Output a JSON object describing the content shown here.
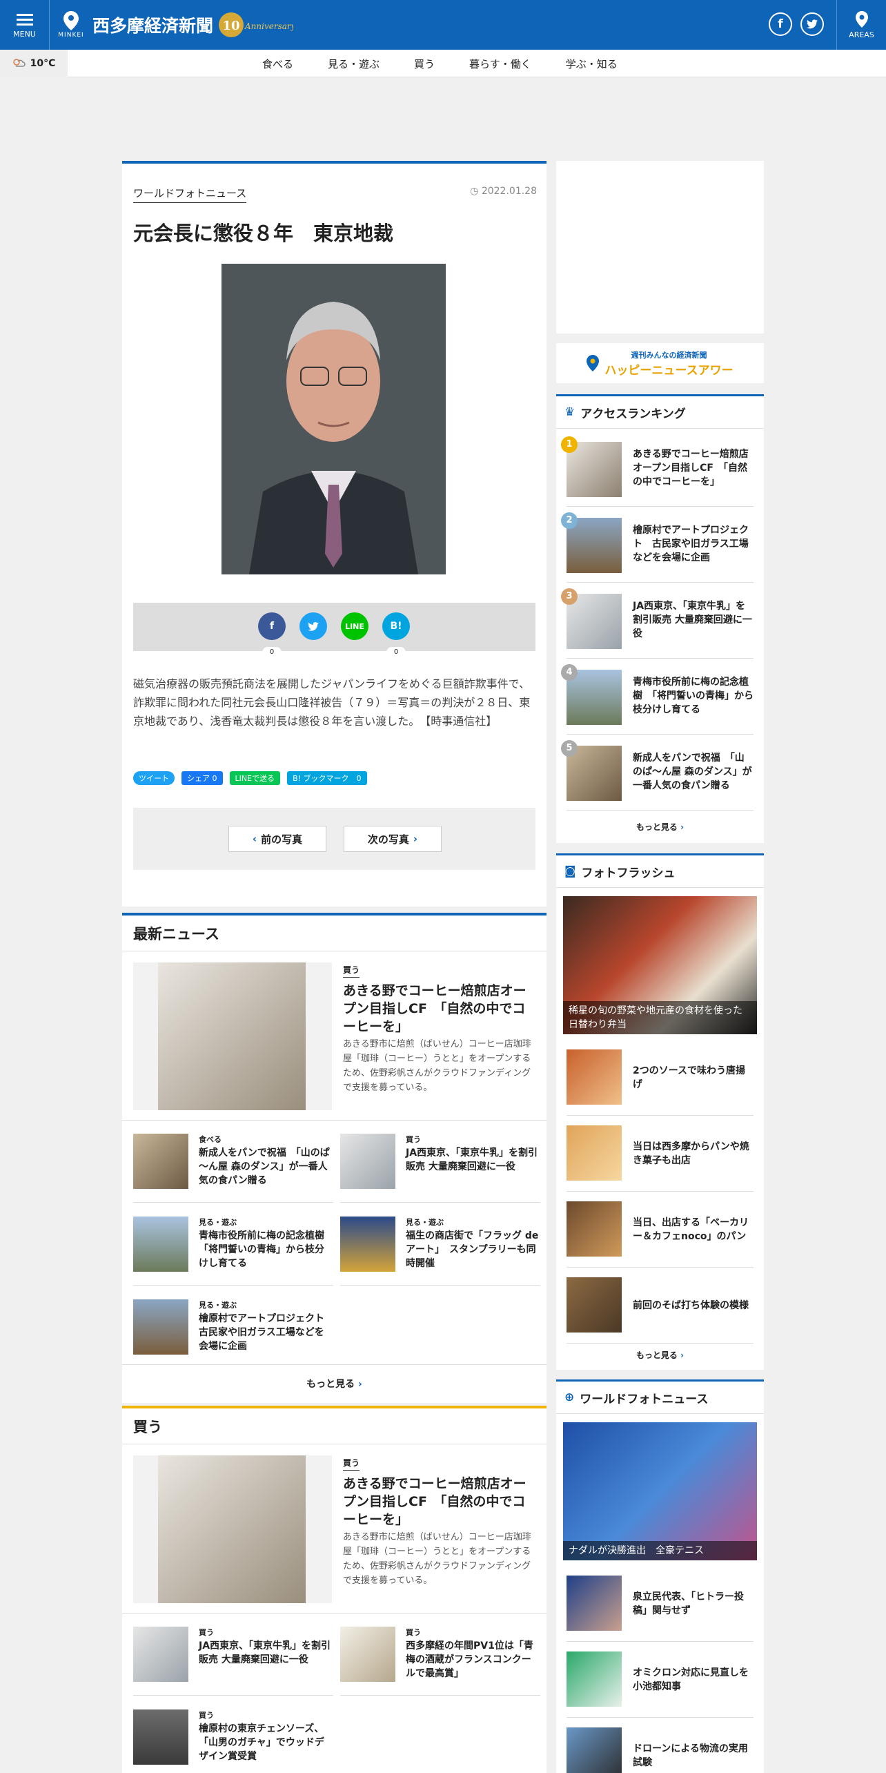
{
  "header": {
    "menu_label": "MENU",
    "minkei_label": "MINKEI",
    "site_title": "西多摩経済新聞",
    "anniv_num": "10",
    "anniv_text": "Anniversary",
    "areas_label": "AREAS",
    "facebook_icon": "f",
    "twitter_icon": "t"
  },
  "weather": {
    "temp": "10°C"
  },
  "nav": [
    "食べる",
    "見る・遊ぶ",
    "買う",
    "暮らす・働く",
    "学ぶ・知る"
  ],
  "article": {
    "category": "ワールドフォトニュース",
    "date": "2022.01.28",
    "title": "元会長に懲役８年　東京地裁",
    "share_fb_count": "0",
    "share_hatena_count": "0",
    "share_line_label": "LINE",
    "share_hatena_label": "B!",
    "body": "磁気治療器の販売預託商法を展開したジャパンライフをめぐる巨額詐欺事件で、詐欺罪に問われた同社元会長山口隆祥被告（７９）＝写真＝の判決が２８日、東京地裁であり、浅香竜太裁判長は懲役８年を言い渡した。　【時事通信社】",
    "mini_tweet": "ツイート",
    "mini_share": "シェア 0",
    "mini_line": "LINEで送る",
    "mini_bookmark": "B! ブックマーク　0",
    "prev_photo": "前の写真",
    "next_photo": "次の写真"
  },
  "latest": {
    "heading": "最新ニュース",
    "feature": {
      "category": "買う",
      "title": "あきる野でコーヒー焙煎店オープン目指しCF　「自然の中でコーヒーを」",
      "desc": "あきる野市に焙煎（ばいせん）コーヒー店珈琲屋「珈琲（コーヒー）うとと」をオープンするため、佐野彩帆さんがクラウドファンディングで支援を募っている。"
    },
    "items": [
      {
        "cat": "食べる",
        "title": "新成人をパンで祝福　「山のぱ～ん屋 森のダンス」が一番人気の食パン贈る"
      },
      {
        "cat": "買う",
        "title": "JA西東京、「東京牛乳」を割引販売 大量廃棄回避に一役"
      },
      {
        "cat": "見る・遊ぶ",
        "title": "青梅市役所前に梅の記念植樹「将門誓いの青梅」から枝分けし育てる"
      },
      {
        "cat": "見る・遊ぶ",
        "title": "福生の商店街で「フラッグ de アート」　スタンプラリーも同時開催"
      },
      {
        "cat": "見る・遊ぶ",
        "title": "檜原村でアートプロジェクト　古民家や旧ガラス工場などを会場に企画"
      }
    ],
    "more": "もっと見る"
  },
  "buy": {
    "heading": "買う",
    "feature": {
      "category": "買う",
      "title": "あきる野でコーヒー焙煎店オープン目指しCF　「自然の中でコーヒーを」",
      "desc": "あきる野市に焙煎（ばいせん）コーヒー店珈琲屋「珈琲（コーヒー）うとと」をオープンするため、佐野彩帆さんがクラウドファンディングで支援を募っている。"
    },
    "items": [
      {
        "cat": "買う",
        "title": "JA西東京、「東京牛乳」を割引販売 大量廃棄回避に一役"
      },
      {
        "cat": "買う",
        "title": "西多摩経の年間PV1位は「青梅の酒蔵がフランスコンクールで最高賞」"
      },
      {
        "cat": "買う",
        "title": "檜原村の東京チェンソーズ、「山男のガチャ」でウッドデザイン賞受賞"
      }
    ]
  },
  "sidebar": {
    "banner_top": "週刊みんなの経済新聞",
    "banner_main": "ハッピーニュースアワー",
    "ranking_heading": "アクセスランキング",
    "ranking": [
      {
        "num": "1",
        "title": "あきる野でコーヒー焙煎店オープン目指しCF　「自然の中でコーヒーを」"
      },
      {
        "num": "2",
        "title": "檜原村でアートプロジェクト　古民家や旧ガラス工場などを会場に企画"
      },
      {
        "num": "3",
        "title": "JA西東京、「東京牛乳」を割引販売 大量廃棄回避に一役"
      },
      {
        "num": "4",
        "title": "青梅市役所前に梅の記念植樹　「将門誓いの青梅」から枝分けし育てる"
      },
      {
        "num": "5",
        "title": "新成人をパンで祝福　「山のぱ～ん屋 森のダンス」が一番人気の食パン贈る"
      }
    ],
    "ranking_more": "もっと見る",
    "flash_heading": "フォトフラッシュ",
    "flash_big_caption": "稀星の旬の野菜や地元産の食材を使った日替わり弁当",
    "flash_items": [
      "2つのソースで味わう唐揚げ",
      "当日は西多摩からパンや焼き菓子も出店",
      "当日、出店する「ベーカリー＆カフェnoco」のパン",
      "前回のそば打ち体験の模様"
    ],
    "flash_more": "もっと見る",
    "world_heading": "ワールドフォトニュース",
    "world_big_caption": "ナダルが決勝進出　全豪テニス",
    "world_items": [
      "泉立民代表、「ヒトラー投稿」関与せず",
      "オミクロン対応に見直しを　小池都知事",
      "ドローンによる物流の実用試験"
    ]
  },
  "colors": {
    "brand": "#0e64b6",
    "rank1": "#f0b400",
    "rank2": "#7fb3d5",
    "rank3": "#d8a06a",
    "rank_other": "#aaaaaa"
  }
}
